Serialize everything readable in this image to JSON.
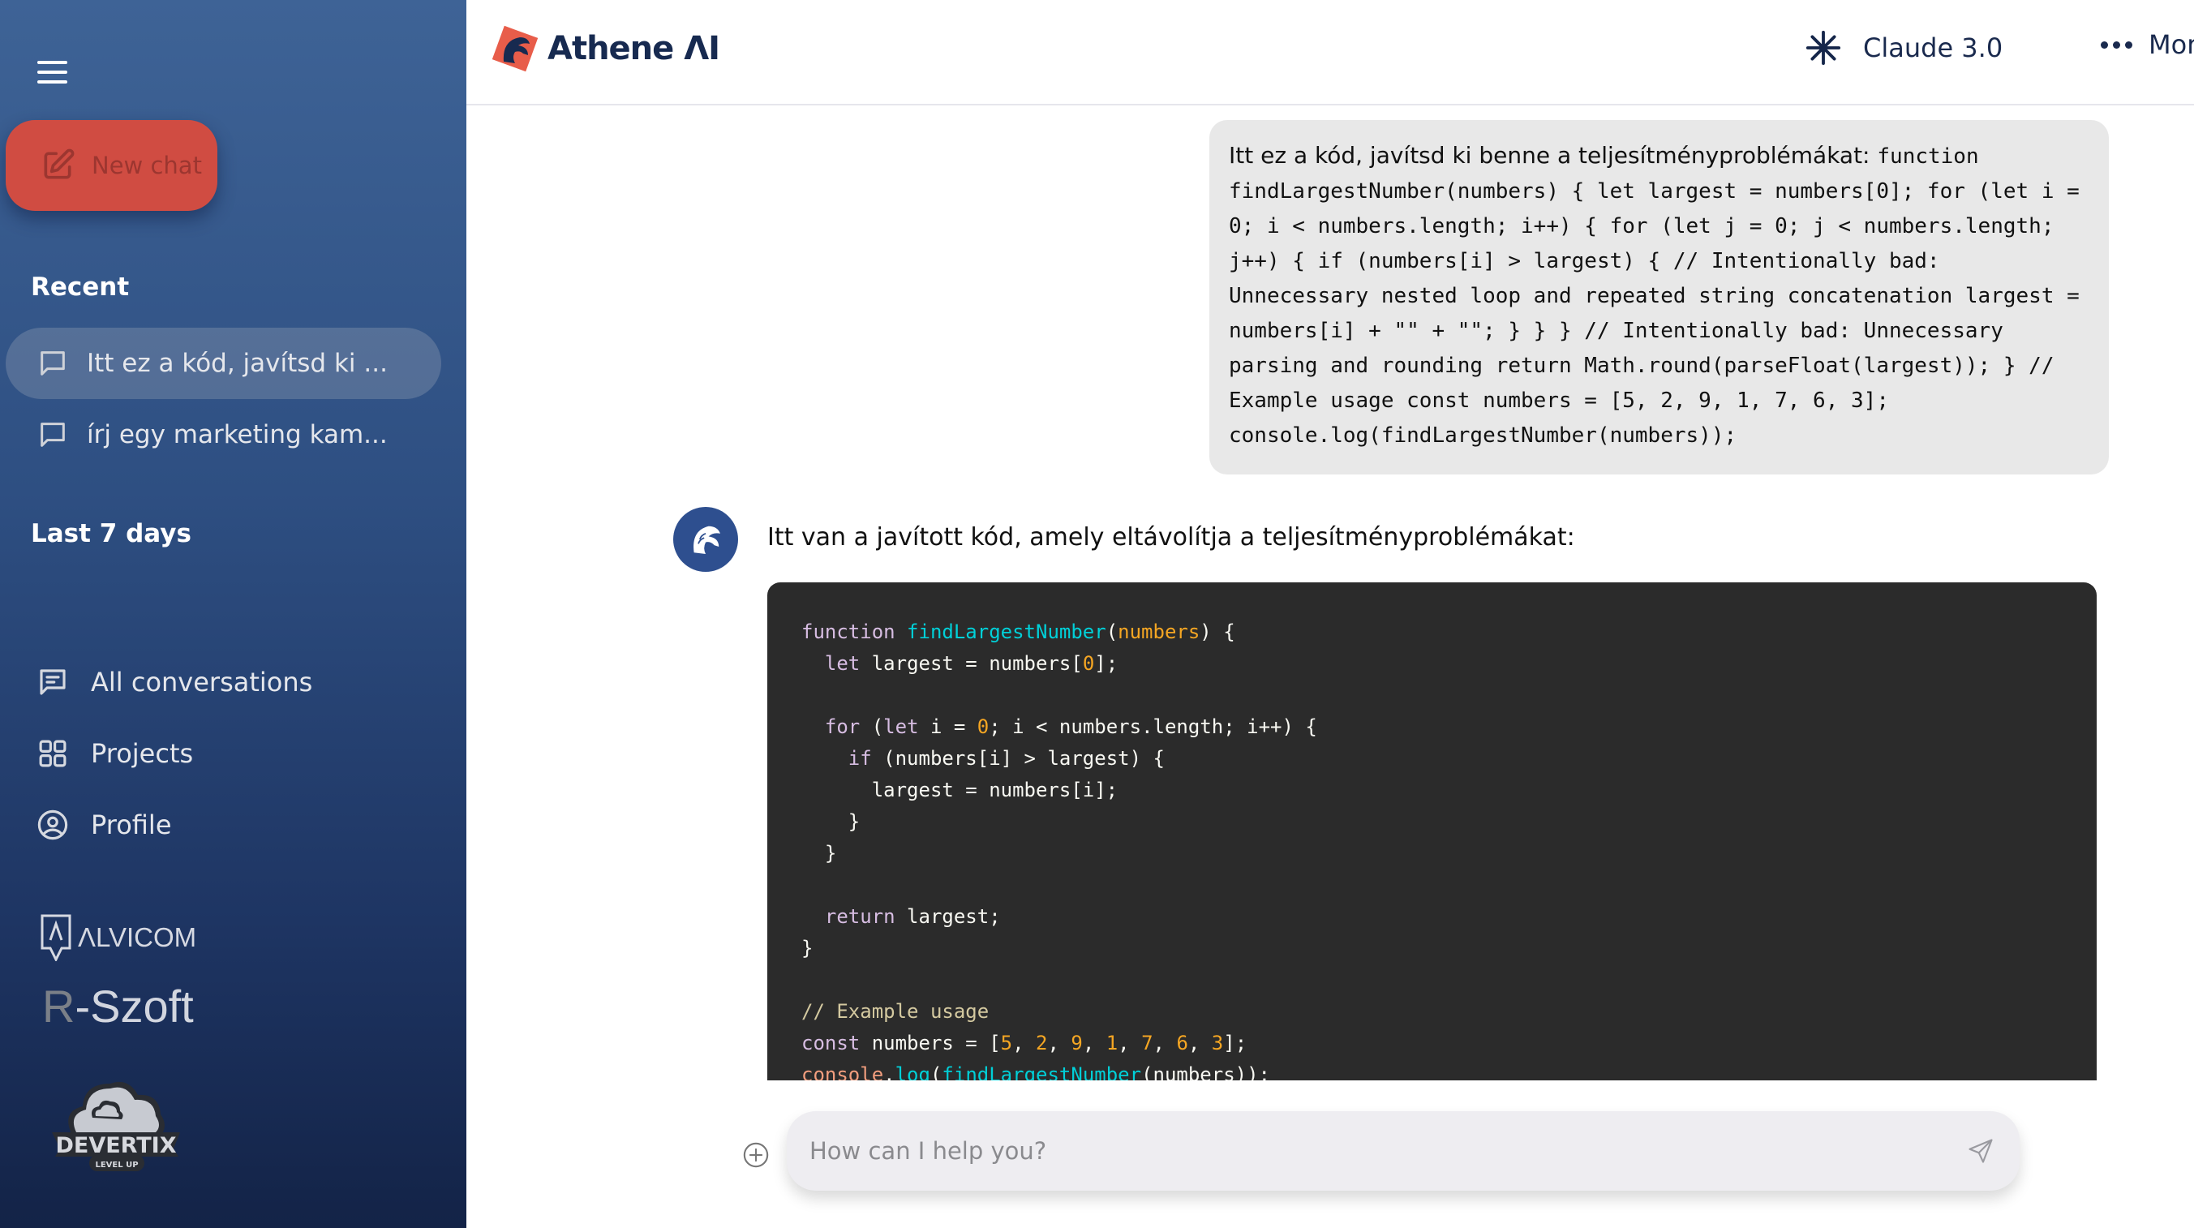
{
  "sidebar": {
    "new_chat_label": "New chat",
    "recent_title": "Recent",
    "recent_items": [
      {
        "label": "Itt ez a kód, javítsd ki ...",
        "active": true
      },
      {
        "label": "írj egy marketing kam...",
        "active": false
      }
    ],
    "last7_title": "Last 7 days",
    "nav": [
      {
        "label": "All conversations",
        "icon": "chat-lines-icon"
      },
      {
        "label": "Projects",
        "icon": "grid-icon"
      },
      {
        "label": "Profile",
        "icon": "user-circle-icon"
      }
    ],
    "partner_logos": {
      "alvicom": "ΛLVICOM",
      "rszoft_r": "R",
      "rszoft_rest": "-Szoft",
      "devertix": "DEVERTIX",
      "devertix_tagline": "LEVEL UP"
    }
  },
  "header": {
    "brand": "Athene ΛI",
    "model_label": "Claude 3.0",
    "more_label": "More"
  },
  "conversation": {
    "user_message": {
      "prose": "Itt ez a kód, javítsd ki benne a teljesítményproblémákat: ",
      "code": "function findLargestNumber(numbers) { let largest = numbers[0]; for (let i = 0; i < numbers.length; i++) { for (let j = 0; j < numbers.length; j++) { if (numbers[i] > largest) { // Intentionally bad: Unnecessary nested loop and repeated string concatenation largest = numbers[i] + \"\" + \"\"; } } } // Intentionally bad: Unnecessary parsing and rounding return Math.round(parseFloat(largest)); } // Example usage const numbers = [5, 2, 9, 1, 7, 6, 3]; console.log(findLargestNumber(numbers));"
    },
    "assistant_message": {
      "text": "Itt van a javított kód, amely eltávolítja a teljesítményproblémákat:",
      "code_lines": [
        [
          {
            "t": "function",
            "c": "kw"
          },
          {
            "t": " "
          },
          {
            "t": "findLargestNumber",
            "c": "fn"
          },
          {
            "t": "("
          },
          {
            "t": "numbers",
            "c": "param"
          },
          {
            "t": ") {"
          }
        ],
        [
          {
            "t": "  "
          },
          {
            "t": "let",
            "c": "kw"
          },
          {
            "t": " largest = numbers["
          },
          {
            "t": "0",
            "c": "num"
          },
          {
            "t": "];"
          }
        ],
        [
          {
            "t": ""
          }
        ],
        [
          {
            "t": "  "
          },
          {
            "t": "for",
            "c": "kw"
          },
          {
            "t": " ("
          },
          {
            "t": "let",
            "c": "kw"
          },
          {
            "t": " i = "
          },
          {
            "t": "0",
            "c": "num"
          },
          {
            "t": "; i < numbers.length; i++) {"
          }
        ],
        [
          {
            "t": "    "
          },
          {
            "t": "if",
            "c": "kw"
          },
          {
            "t": " (numbers[i] > largest) {"
          }
        ],
        [
          {
            "t": "      largest = numbers[i];"
          }
        ],
        [
          {
            "t": "    }"
          }
        ],
        [
          {
            "t": "  }"
          }
        ],
        [
          {
            "t": ""
          }
        ],
        [
          {
            "t": "  "
          },
          {
            "t": "return",
            "c": "kw"
          },
          {
            "t": " largest;"
          }
        ],
        [
          {
            "t": "}"
          }
        ],
        [
          {
            "t": ""
          }
        ],
        [
          {
            "t": "// Example usage",
            "c": "comment"
          }
        ],
        [
          {
            "t": "const",
            "c": "kw"
          },
          {
            "t": " numbers = ["
          },
          {
            "t": "5",
            "c": "num"
          },
          {
            "t": ", "
          },
          {
            "t": "2",
            "c": "num"
          },
          {
            "t": ", "
          },
          {
            "t": "9",
            "c": "num"
          },
          {
            "t": ", "
          },
          {
            "t": "1",
            "c": "num"
          },
          {
            "t": ", "
          },
          {
            "t": "7",
            "c": "num"
          },
          {
            "t": ", "
          },
          {
            "t": "6",
            "c": "num"
          },
          {
            "t": ", "
          },
          {
            "t": "3",
            "c": "num"
          },
          {
            "t": "];"
          }
        ],
        [
          {
            "t": "console",
            "c": "obj"
          },
          {
            "t": "."
          },
          {
            "t": "log",
            "c": "fn"
          },
          {
            "t": "("
          },
          {
            "t": "findLargestNumber",
            "c": "fn"
          },
          {
            "t": "(numbers));"
          }
        ]
      ]
    }
  },
  "composer": {
    "placeholder": "How can I help you?",
    "value": ""
  },
  "colors": {
    "sidebar_top": "#3e6396",
    "sidebar_bottom": "#132347",
    "new_chat_bg": "#d04c42",
    "brand_red": "#e85d4a",
    "brand_navy": "#172a50",
    "code_bg": "#2b2b2b"
  }
}
